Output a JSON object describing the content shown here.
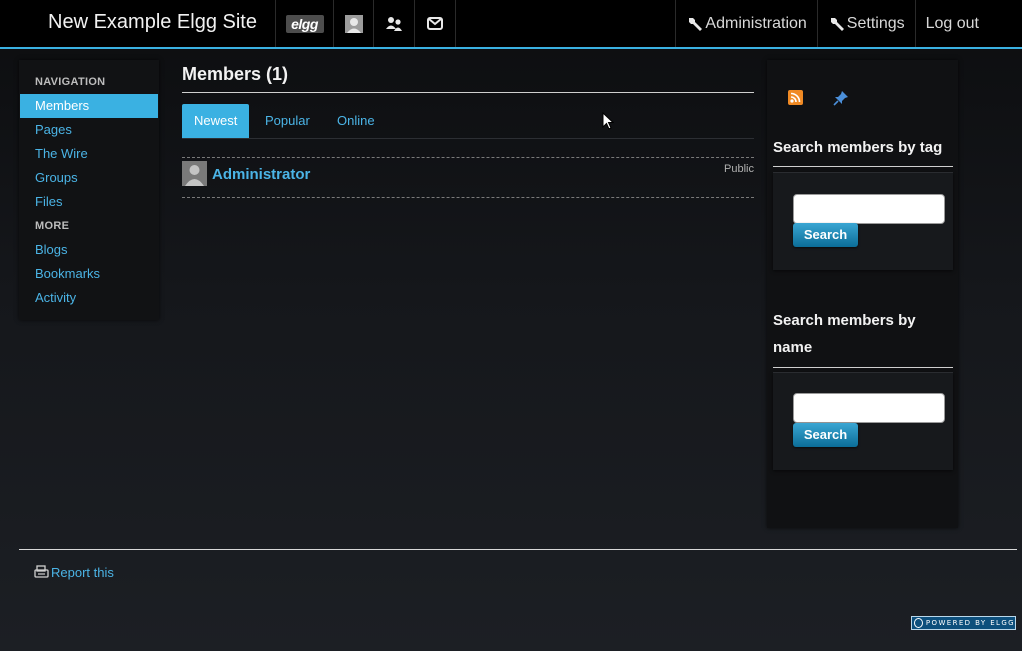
{
  "header": {
    "site_title": "New Example Elgg Site",
    "logo_text": "elgg",
    "icons": [
      "elgg-logo",
      "user-avatar-icon",
      "friends-icon",
      "messages-icon"
    ],
    "admin_label": "Administration",
    "settings_label": "Settings",
    "logout_label": "Log out",
    "accent_color": "#3ab1e2"
  },
  "sidebar": {
    "nav_heading": "NAVIGATION",
    "nav_items": [
      {
        "label": "Members",
        "active": true
      },
      {
        "label": "Pages"
      },
      {
        "label": "The Wire"
      },
      {
        "label": "Groups"
      },
      {
        "label": "Files"
      }
    ],
    "more_heading": "MORE",
    "more_items": [
      {
        "label": "Blogs"
      },
      {
        "label": "Bookmarks"
      },
      {
        "label": "Activity"
      }
    ]
  },
  "main": {
    "title": "Members (1)",
    "tabs": [
      {
        "label": "Newest",
        "active": true
      },
      {
        "label": "Popular"
      },
      {
        "label": "Online"
      }
    ],
    "members": [
      {
        "name": "Administrator",
        "access": "Public"
      }
    ]
  },
  "right_sidebar": {
    "icons": [
      "rss-icon",
      "pin-icon"
    ],
    "tag_search": {
      "heading": "Search members by tag",
      "value": "",
      "button": "Search"
    },
    "name_search": {
      "heading_line1": "Search members by",
      "heading_line2": "name",
      "value": "",
      "button": "Search"
    }
  },
  "footer": {
    "report_label": "Report this",
    "powered_by": "POWERED BY ELGG"
  }
}
